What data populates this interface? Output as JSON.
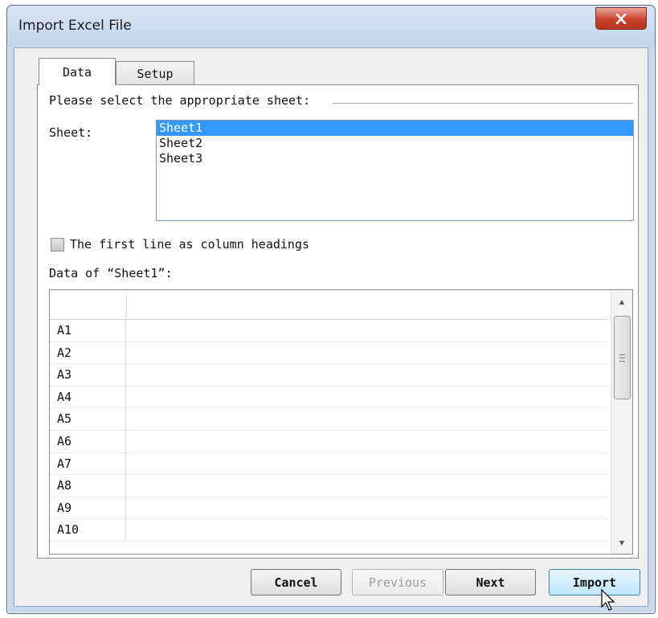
{
  "window": {
    "title": "Import Excel File",
    "close_icon": "close-x-icon"
  },
  "tabs": [
    {
      "label": "Data",
      "active": true
    },
    {
      "label": "Setup",
      "active": false
    }
  ],
  "data_tab": {
    "section_label": "Please select the appropriate sheet:",
    "sheet_label": "Sheet:",
    "sheets": [
      "Sheet1",
      "Sheet2",
      "Sheet3"
    ],
    "selected_sheet": "Sheet1",
    "first_line_headings_label": "The first line as column headings",
    "first_line_headings_checked": false,
    "data_of_label": "Data of “Sheet1”:",
    "grid_rows": [
      "A1",
      "A2",
      "A3",
      "A4",
      "A5",
      "A6",
      "A7",
      "A8",
      "A9",
      "A10"
    ]
  },
  "buttons": {
    "cancel": "Cancel",
    "previous": "Previous",
    "next": "Next",
    "import": "Import"
  },
  "colors": {
    "selection": "#3399ff",
    "title_bar": "#c9d9ec",
    "close_button": "#c9412a"
  }
}
